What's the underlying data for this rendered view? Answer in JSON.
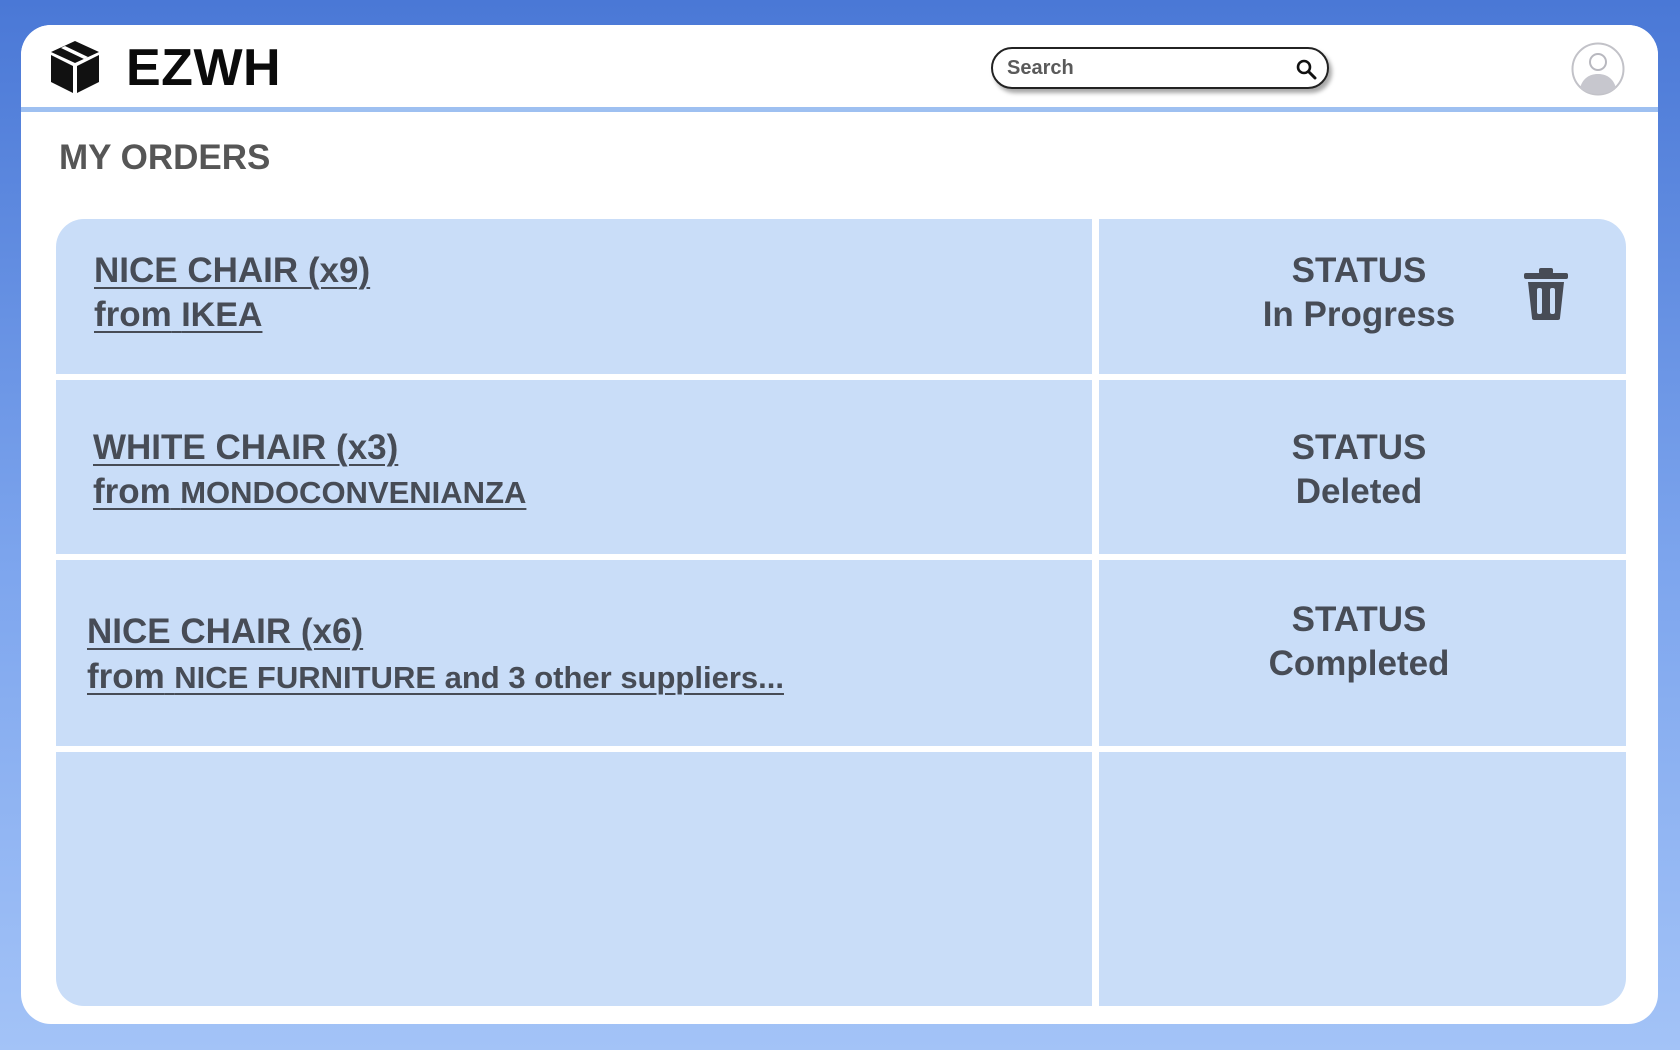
{
  "app": {
    "title": "EZWH"
  },
  "header": {
    "search": {
      "placeholder": "Search",
      "value": ""
    },
    "icons": {
      "logo": "package-box-icon",
      "search": "magnifier-icon",
      "avatar": "user-avatar-icon"
    }
  },
  "page": {
    "title": "MY ORDERS"
  },
  "orders": [
    {
      "title": "NICE CHAIR (x9)",
      "from_word": "from",
      "supplier": "IKEA",
      "status_label": "STATUS",
      "status": "In Progress",
      "has_delete": true
    },
    {
      "title": "WHITE CHAIR (x3)",
      "from_word": "from",
      "supplier": "MONDOCONVENIANZA",
      "status_label": "STATUS",
      "status": "Deleted",
      "has_delete": false
    },
    {
      "title": "NICE CHAIR (x6)",
      "from_word": "from",
      "supplier": "NICE FURNITURE and 3 other suppliers...",
      "status_label": "STATUS",
      "status": "Completed",
      "has_delete": false
    }
  ],
  "colors": {
    "background_top": "#4a78d6",
    "background_bottom": "#a3c3f7",
    "row_fill": "#c9ddf8",
    "header_divider": "#9ec0f1",
    "text": "#474c56"
  }
}
